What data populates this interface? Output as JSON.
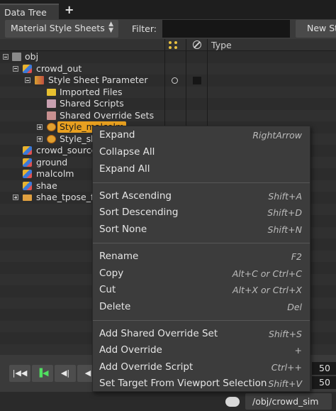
{
  "tab": {
    "label": "Data Tree",
    "add": "+"
  },
  "toolbar": {
    "dropdown": "Material Style Sheets",
    "filter_label": "Filter:",
    "new_button": "New St"
  },
  "columns": {
    "type": "Type"
  },
  "tree": {
    "obj": "obj",
    "crowd_out": "crowd_out",
    "style_sheet_parameter": "Style Sheet Parameter",
    "imported_files": "Imported Files",
    "shared_scripts": "Shared Scripts",
    "shared_override_sets": "Shared Override Sets",
    "style_malcolm": "Style_malcolm",
    "style_sh": "Style_sh",
    "crowd_source": "crowd_source",
    "ground": "ground",
    "malcolm": "malcolm",
    "shae": "shae",
    "shae_tpose": "shae_tpose_fb"
  },
  "context_menu": [
    {
      "label": "Expand",
      "shortcut": "RightArrow"
    },
    {
      "label": "Collapse All",
      "shortcut": ""
    },
    {
      "label": "Expand All",
      "shortcut": ""
    },
    {
      "label": "Sort Ascending",
      "shortcut": "Shift+A"
    },
    {
      "label": "Sort Descending",
      "shortcut": "Shift+D"
    },
    {
      "label": "Sort None",
      "shortcut": "Shift+N"
    },
    {
      "label": "Rename",
      "shortcut": "F2"
    },
    {
      "label": "Copy",
      "shortcut": "Alt+C or Ctrl+C"
    },
    {
      "label": "Cut",
      "shortcut": "Alt+X or Ctrl+X"
    },
    {
      "label": "Delete",
      "shortcut": "Del"
    },
    {
      "label": "Add Shared Override Set",
      "shortcut": "Shift+S"
    },
    {
      "label": "Add Override",
      "shortcut": "+"
    },
    {
      "label": "Add Override Script",
      "shortcut": "Ctrl++"
    },
    {
      "label": "Set Target From Viewport Selection",
      "shortcut": "Shift+V"
    }
  ],
  "playbar": {
    "frame_end_1": "50",
    "frame_end_2": "50"
  },
  "status": {
    "path": "/obj/crowd_sim"
  },
  "colors": {
    "highlight": "#e8a020",
    "menu_bg": "#3c3c3c",
    "play_green": "#50e060"
  }
}
